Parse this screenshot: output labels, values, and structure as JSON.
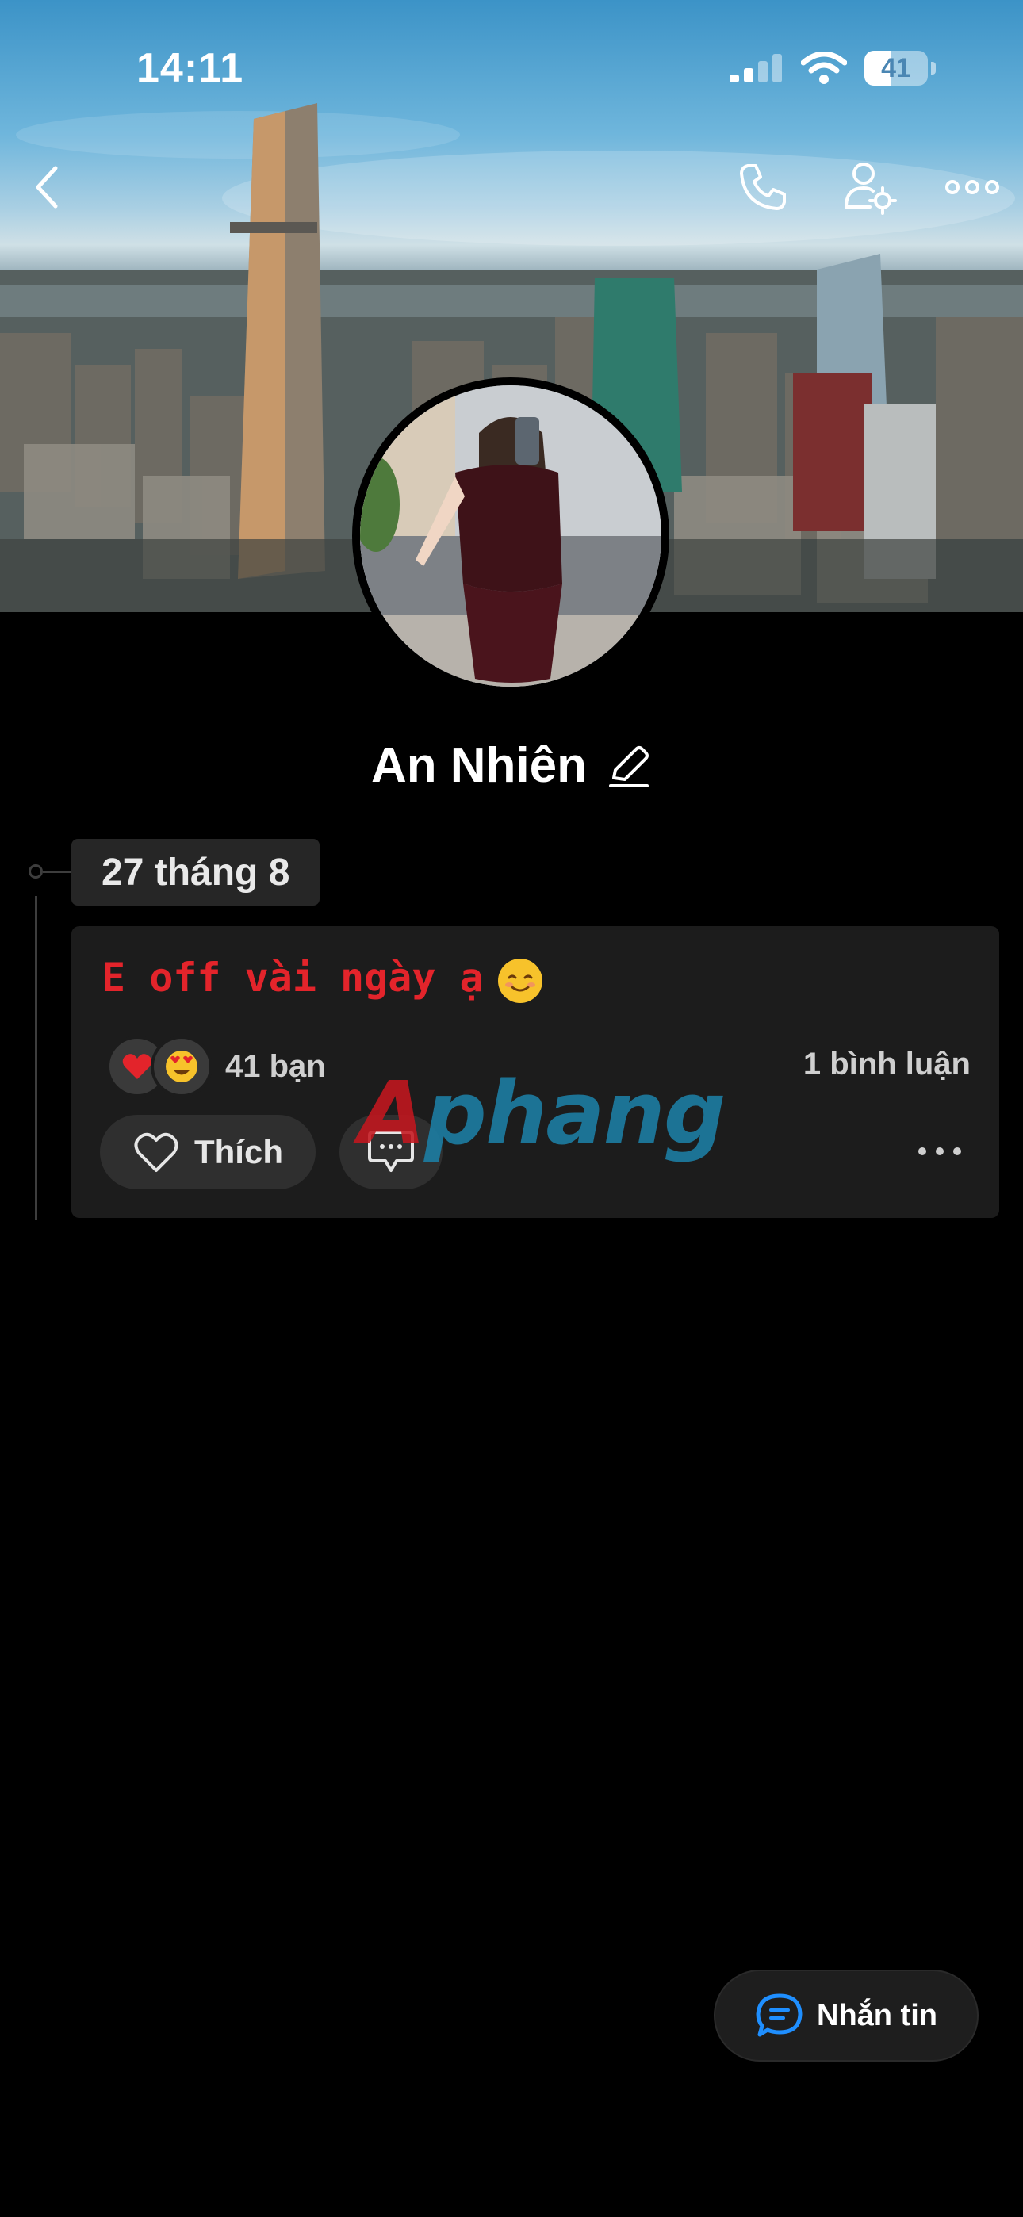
{
  "status_bar": {
    "time": "14:11",
    "battery_level": "41",
    "signal_icon": "cellular-signal-icon",
    "wifi_icon": "wifi-icon"
  },
  "nav": {
    "back_icon": "chevron-left-icon",
    "call_icon": "phone-icon",
    "settings_icon": "user-settings-icon",
    "more_icon": "more-horizontal-icon"
  },
  "profile": {
    "name": "An Nhiên",
    "edit_icon": "pencil-icon"
  },
  "timeline": {
    "date_label": "27 tháng 8",
    "post": {
      "text": "E off vài ngày ạ",
      "reactions_label": "41 bạn",
      "comments_label": "1 bình luận",
      "like_label": "Thích"
    }
  },
  "watermark": {
    "first_letter": "A",
    "rest": "phang"
  },
  "footer": {
    "message_label": "Nhắn tin"
  },
  "colors": {
    "background": "#000000",
    "card": "#1c1c1c",
    "post_text": "#e3242b",
    "accent_blue": "#1f8fff"
  }
}
